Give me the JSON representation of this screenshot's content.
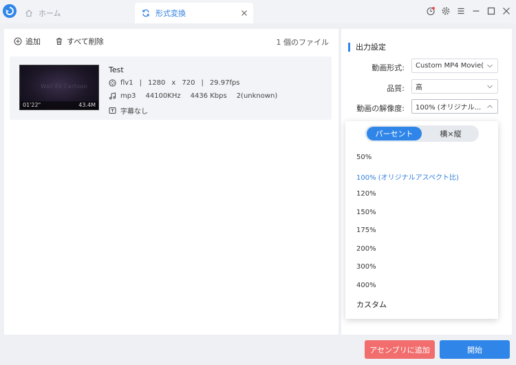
{
  "colors": {
    "accent": "#2f86e8",
    "danger": "#f26d6d",
    "tab_active_text": "#2f7fe0"
  },
  "tabs": {
    "home": {
      "label": "ホーム",
      "icon": "home-icon"
    },
    "convert": {
      "label": "形式変換",
      "icon": "refresh-icon"
    }
  },
  "toolbar": {
    "add_label": "追加",
    "delete_all_label": "すべて削除",
    "file_count": "1 個のファイル"
  },
  "file": {
    "name": "Test",
    "thumb_title": "Wall Ex Cartoon",
    "duration": "01'22\"",
    "size": "43.4M",
    "video_codec": "flv1",
    "sep1": "|",
    "width": "1280",
    "times": "x",
    "height": "720",
    "sep2": "|",
    "fps": "29.97fps",
    "audio_codec": "mp3",
    "sample_rate": "44100KHz",
    "bitrate": "4436 Kbps",
    "channels": "2(unknown)",
    "subtitle": "字幕なし"
  },
  "settings": {
    "title": "出力設定",
    "format_label": "動画形式:",
    "format_value": "Custom MP4 Movie(...",
    "quality_label": "品質:",
    "quality_value": "高",
    "resolution_label": "動画の解像度:",
    "resolution_value": "100% (オリジナル..."
  },
  "dropdown": {
    "seg_percent": "パーセント",
    "seg_ratio": "横×縦",
    "options": [
      "50%",
      "100% (オリジナルアスペクト比)",
      "120%",
      "150%",
      "175%",
      "200%",
      "300%",
      "400%",
      "カスタム"
    ],
    "selected_index": 1
  },
  "buttons": {
    "assemble": "アセンブリに追加",
    "start": "開始"
  }
}
